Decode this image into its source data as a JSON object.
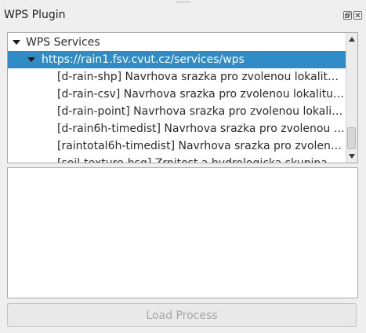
{
  "window": {
    "title": "WPS Plugin"
  },
  "tree": {
    "root_label": "WPS Services",
    "server_url": "https://rain1.fsv.cvut.cz/services/wps",
    "processes": [
      "[d-rain-shp] Navrhova srazka pro zvolenou lokalit…",
      "[d-rain-csv] Navrhova srazka pro zvolenou lokalitu…",
      "[d-rain-point] Navrhova srazka pro zvolenou lokali…",
      "[d-rain6h-timedist] Navrhova srazka pro zvolenou …",
      "[raintotal6h-timedist] Navrhova srazka pro zvolen…",
      "[soil-texture-hsg] Zrnitost a hydrologicka skupina…"
    ]
  },
  "description": {
    "text": ""
  },
  "actions": {
    "load_process_label": "Load Process",
    "load_process_enabled": false
  },
  "colors": {
    "selection": "#308cc6",
    "panel_background": "#efefef",
    "disabled_text": "#a6a6a6"
  },
  "icons": {
    "expand_arrow": "triangle-down-icon",
    "float": "float-window-icon",
    "close": "close-icon"
  }
}
